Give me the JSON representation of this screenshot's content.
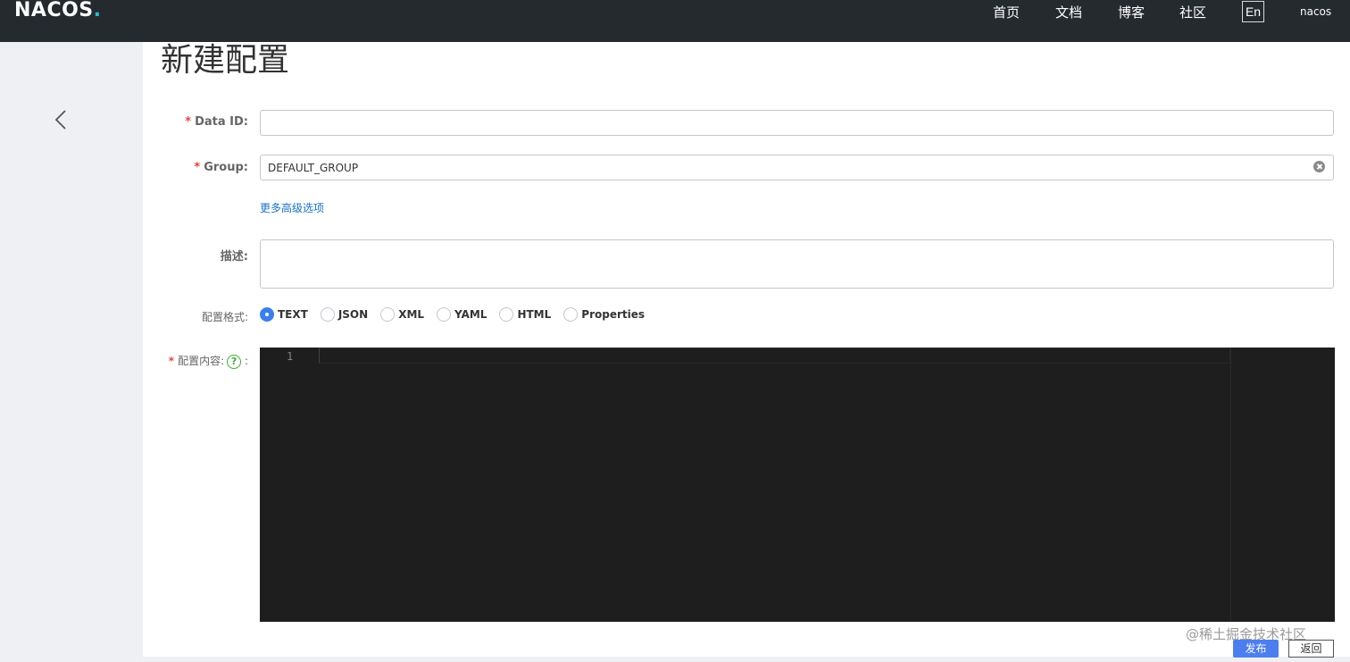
{
  "header": {
    "logo_text": "NACOS",
    "logo_dot": ".",
    "nav": [
      "首页",
      "文档",
      "博客",
      "社区"
    ],
    "lang": "En",
    "user": "nacos"
  },
  "page": {
    "title": "新建配置"
  },
  "form": {
    "data_id": {
      "label": "Data ID:",
      "required_mark": "*",
      "value": ""
    },
    "group": {
      "label": "Group:",
      "required_mark": "*",
      "value": "DEFAULT_GROUP"
    },
    "advanced_link": "更多高级选项",
    "description": {
      "label": "描述:",
      "value": ""
    },
    "format": {
      "label": "配置格式:",
      "options": [
        "TEXT",
        "JSON",
        "XML",
        "YAML",
        "HTML",
        "Properties"
      ],
      "selected": "TEXT"
    },
    "content": {
      "label": "配置内容:",
      "required_mark": "*",
      "help_glyph": "?",
      "suffix": ":",
      "line_number": "1"
    }
  },
  "actions": {
    "publish": "发布",
    "return": "返回"
  },
  "watermark": "@稀土掘金技术社区",
  "colors": {
    "topbar": "#252a2f",
    "primary": "#4d7ef0",
    "required": "#e8453c",
    "link": "#1a73c6",
    "editor_bg": "#1e1e1e",
    "help": "#3bb030"
  },
  "icons": {
    "back": "chevron-left-icon",
    "clear": "clear-circle-icon",
    "help": "question-circle-icon"
  }
}
